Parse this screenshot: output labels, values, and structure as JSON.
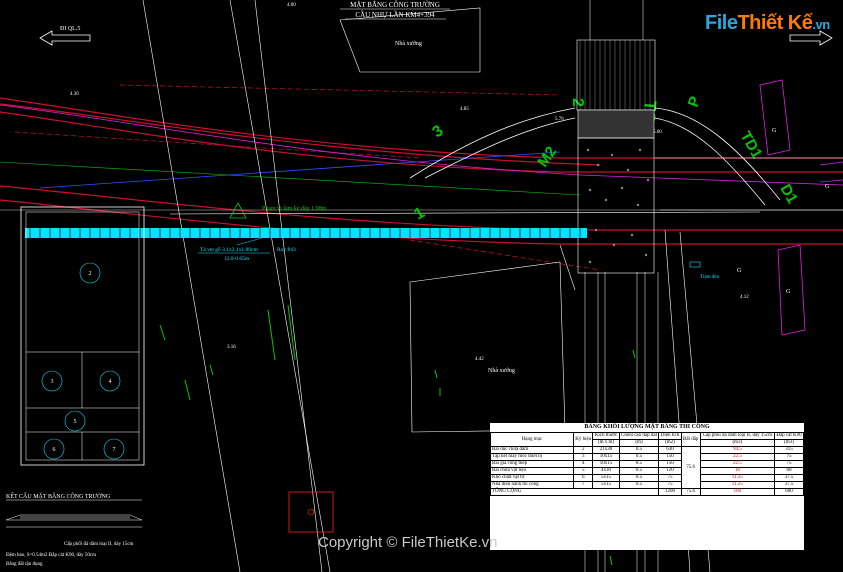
{
  "drawing": {
    "title": "MẶT BẰNG CÔNG TRƯỜNG",
    "subtitle": "CẦU NHỰ LẦN KM4+394",
    "direction_label": "ĐI QL.5",
    "house_top": "Nhà xưởng",
    "house_bottom": "Nhà xưởng",
    "elevations": [
      "4.00",
      "4.30",
      "4.85",
      "5.76",
      "5.60",
      "3.16",
      "4.42",
      "4.12"
    ],
    "labels": {
      "tc1": "TC1",
      "m2": "M2",
      "td1": "TD1",
      "d1": "D1",
      "p": "P",
      "num1": "1",
      "num2": "2",
      "num3": "3",
      "road_note": "Phạm vi làm kè dày 1.98m",
      "pipe_note": "Tà vẹt gỗ 3.1x2.1x1.80cm",
      "pipe_sub": "l2.0-0.65m",
      "ray_note": "Ray P43",
      "tram_den": "Trạm đèn",
      "g": "G",
      "section_title": "KẾT CẤU MẶT BẰNG CÔNG TRƯỜNG",
      "sec1": "Cấp phối đá dăm loại II, dày 15cm",
      "sec2": "Đệm bao, S=0.54m2 Đắp cát K90, dày 50cm",
      "sec3": "Bằng đất tận dụng"
    },
    "plan_numbers": [
      "2",
      "3",
      "4",
      "5",
      "6",
      "7"
    ]
  },
  "table": {
    "caption": "BẢNG KHỐI LƯỢNG MẶT BẰNG THI CÔNG",
    "headers": [
      "Hạng mục",
      "Ký hiệu",
      "Kích thước",
      "Chiều cao đắp đất",
      "Diện tích",
      "Đất đắp",
      "Cấp phối đá dăm loại II, dày 15cm",
      "Đắp cát K90"
    ],
    "units": [
      "(m x m)",
      "(m)",
      "(m2)",
      "(m3)",
      "(m3)"
    ],
    "rows": [
      {
        "name": "Bãi đúc chứa dầm",
        "code": "2",
        "size": "21x30",
        "h": "0.5",
        "area": "630",
        "cp": "94.5",
        "k90": "315"
      },
      {
        "name": "Tập kết máy móc thiết bị",
        "code": "3",
        "size": "10x15",
        "h": "0.5",
        "area": "150",
        "cp": "22.5",
        "k90": "75"
      },
      {
        "name": "Bãi gia công thép",
        "code": "4",
        "size": "10x15",
        "h": "0.5",
        "area": "150",
        "cp": "22.5",
        "k90": "75"
      },
      {
        "name": "Bãi chứa vật liệu",
        "code": "5",
        "size": "4x30",
        "h": "0.5",
        "area": "120",
        "cp": "18",
        "k90": "60"
      },
      {
        "name": "Kho chứa vật tư",
        "code": "6",
        "size": "5x15",
        "h": "0.5",
        "area": "75",
        "cp": "11.25",
        "k90": "37.5"
      },
      {
        "name": "Nhà điều hành thi công",
        "code": "7",
        "size": "5x15",
        "h": "0.5",
        "area": "75",
        "cp": "11.25",
        "k90": "37.5"
      }
    ],
    "fill_value": "75.6",
    "total": {
      "name": "TỔNG CỘNG",
      "area": "1200",
      "fill": "75.6",
      "cp": "180",
      "k90": "600"
    }
  },
  "watermark": {
    "brand_a": "File",
    "brand_b": "Thiết Kế",
    "brand_c": ".vn",
    "copyright": "Copyright © FileThietKe.vn"
  },
  "colors": {
    "background": "#000000",
    "road_red": "#c8102e",
    "pipe_cyan": "#00e5ff",
    "green": "#00c800",
    "magenta": "#e020e0",
    "blue": "#3050ff"
  }
}
